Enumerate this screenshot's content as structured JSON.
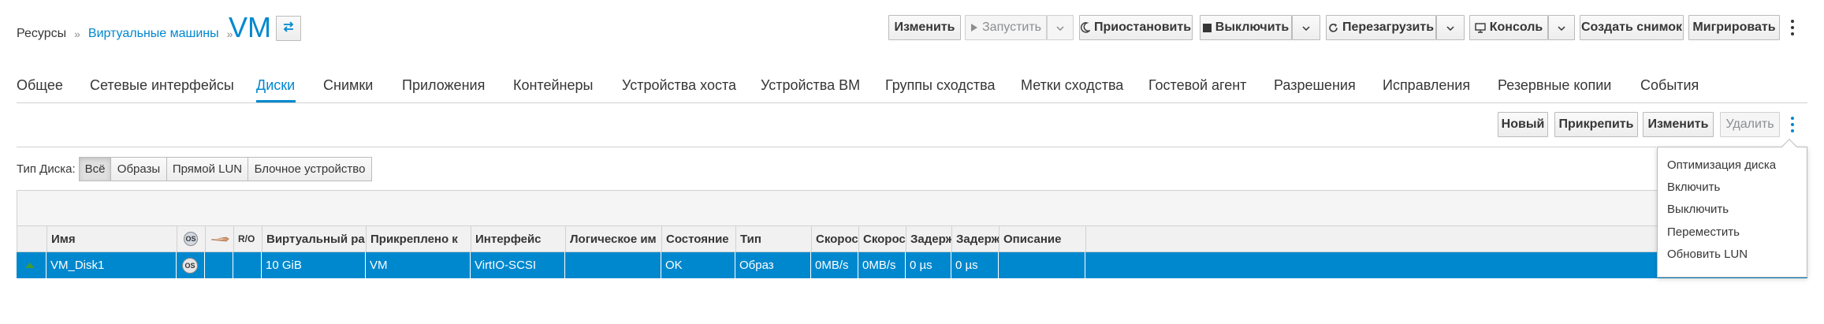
{
  "breadcrumb": {
    "root": "Ресурсы",
    "section": "Виртуальные машины",
    "separator": "»"
  },
  "page_title": "VM",
  "icons": {
    "swap": "swap-icon",
    "play": "play-icon",
    "moon": "moon-icon",
    "stop": "stop-icon",
    "reload": "reload-icon",
    "monitor": "monitor-icon",
    "caret": "caret-down-icon",
    "kebab": "kebab-icon",
    "status_up": "arrow-up-icon",
    "os": "os-icon",
    "bootable": "bootable-icon"
  },
  "toolbar": {
    "edit": "Изменить",
    "run": "Запустить",
    "suspend": "Приостановить",
    "shutdown": "Выключить",
    "reboot": "Перезагрузить",
    "console": "Консоль",
    "snapshot": "Создать снимок",
    "migrate": "Мигрировать"
  },
  "tabs": [
    "Общее",
    "Сетевые интерфейсы",
    "Диски",
    "Снимки",
    "Приложения",
    "Контейнеры",
    "Устройства хоста",
    "Устройства ВМ",
    "Группы сходства",
    "Метки сходства",
    "Гостевой агент",
    "Разрешения",
    "Исправления",
    "Резервные копии",
    "События"
  ],
  "active_tab": "Диски",
  "disk_actions": {
    "new": "Новый",
    "attach": "Прикрепить",
    "edit": "Изменить",
    "remove": "Удалить"
  },
  "filter": {
    "label": "Тип Диска:",
    "options": [
      "Всё",
      "Образы",
      "Прямой LUN",
      "Блочное устройство"
    ],
    "selected": "Всё"
  },
  "table": {
    "columns": {
      "name": "Имя",
      "os_icon": "OS",
      "ro": "R/O",
      "virtual_size": "Виртуальный ра",
      "attached_to": "Прикреплено к",
      "interface": "Интерфейс",
      "logical_name": "Логическое им",
      "status": "Состояние",
      "type": "Тип",
      "speed_read": "Скорост",
      "speed_write": "Скорост",
      "latency_read": "Задерж",
      "latency_write": "Задерж",
      "description": "Описание"
    },
    "rows": [
      {
        "name": "VM_Disk1",
        "os_icon": "OS",
        "virtual_size": "10 GiB",
        "attached_to": "VM",
        "interface": "VirtIO-SCSI",
        "logical_name": "",
        "status": "OK",
        "type": "Образ",
        "speed_read": "0MB/s",
        "speed_write": "0MB/s",
        "latency_read": "0 µs",
        "latency_write": "0 µs",
        "description": ""
      }
    ]
  },
  "kebab_menu": {
    "items": [
      "Оптимизация диска",
      "Включить",
      "Выключить",
      "Переместить",
      "Обновить LUN"
    ]
  },
  "colors": {
    "accent": "#0088ce",
    "selected_row": "#0088ce",
    "status_up": "#3f9c35"
  }
}
